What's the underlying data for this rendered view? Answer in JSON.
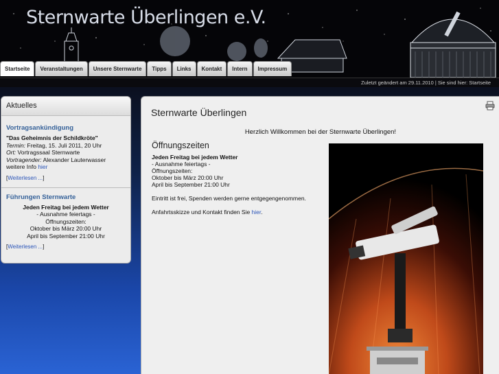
{
  "site": {
    "title": "Sternwarte Überlingen e.V."
  },
  "nav": {
    "tabs": [
      {
        "label": "Startseite"
      },
      {
        "label": "Veranstaltungen"
      },
      {
        "label": "Unsere Sternwarte"
      },
      {
        "label": "Tipps"
      },
      {
        "label": "Links"
      },
      {
        "label": "Kontakt"
      },
      {
        "label": "Intern"
      },
      {
        "label": "Impressum"
      }
    ]
  },
  "status": {
    "text": "Zuletzt geändert am 29.11.2010 | Sie sind hier: Startseite"
  },
  "sidebar": {
    "heading": "Aktuelles",
    "talk": {
      "heading": "Vortragsankündigung",
      "title": "\"Das Geheimnis der Schildkröte\"",
      "date_label": "Termin:",
      "date_value": " Freitag, 15. Juli 2011, 20 Uhr",
      "place_label": "Ort:",
      "place_value": " Vortragssaal Sternwarte",
      "speaker_label": "Vortragender:",
      "speaker_value": " Alexander Lauterwasser",
      "info_text": "weitere Info ",
      "info_link": "hier",
      "more_open": "[",
      "more_link": "Weiterlesen ...",
      "more_close": "]"
    },
    "tours": {
      "heading": "Führungen Sternwarte",
      "line1": "Jeden Freitag bei jedem Wetter",
      "line2": "- Ausnahme feiertags -",
      "line3": "Öffnungszeiten:",
      "line4": "Oktober bis März 20:00 Uhr",
      "line5": "April bis September 21:00 Uhr",
      "more_open": "[",
      "more_link": "Weiterlesen ...",
      "more_close": "]"
    }
  },
  "main": {
    "title": "Sternwarte Überlingen",
    "welcome": "Herzlich Willkommen bei der Sternwarte Überlingen!",
    "hours_heading": "Öffnungszeiten",
    "line1": "Jeden Freitag bei jedem Wetter",
    "line2": "- Ausnahme feiertags -",
    "line3": "Öffnungszeiten:",
    "line4": "Oktober bis März 20:00 Uhr",
    "line5": "April bis September 21:00 Uhr",
    "entry": "Eintritt ist frei, Spenden werden gerne entgegengenommen.",
    "directions_text": "Anfahrtsskizze und Kontakt finden Sie ",
    "directions_link": "hier",
    "directions_end": "."
  },
  "icons": {
    "print": "printer-icon"
  }
}
